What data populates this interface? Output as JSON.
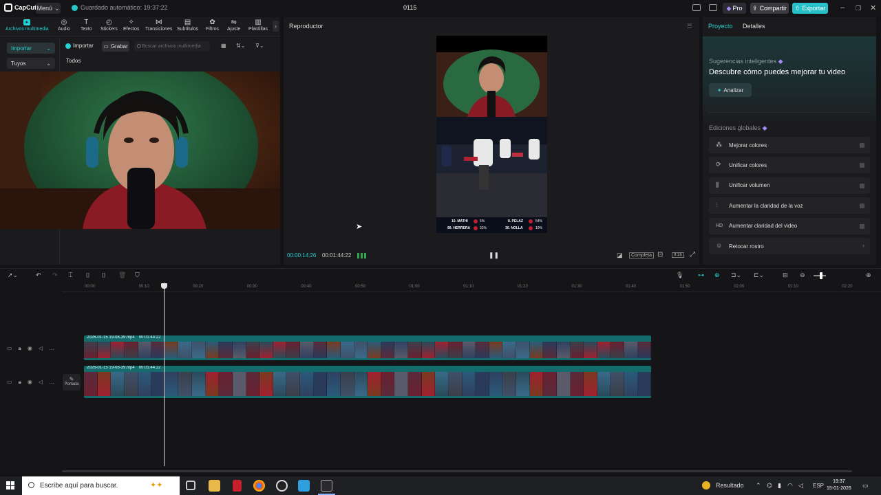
{
  "titlebar": {
    "app_name": "CapCut",
    "menu_label": "Menú",
    "autosave": "Guardado automático: 19:37:22",
    "project_name": "0115",
    "pro_label": "Pro",
    "share_label": "Compartir",
    "export_label": "Exportar"
  },
  "toolbar": {
    "tools": [
      {
        "label": "Archivos multimedia",
        "icon": "media-icon"
      },
      {
        "label": "Audio",
        "icon": "audio-icon"
      },
      {
        "label": "Texto",
        "icon": "text-icon"
      },
      {
        "label": "Stickers",
        "icon": "sticker-icon"
      },
      {
        "label": "Efectos",
        "icon": "effects-icon"
      },
      {
        "label": "Transiciones",
        "icon": "transitions-icon"
      },
      {
        "label": "Subtítulos",
        "icon": "subtitles-icon"
      },
      {
        "label": "Filtros",
        "icon": "filters-icon"
      },
      {
        "label": "Ajuste",
        "icon": "adjust-icon"
      },
      {
        "label": "Plantillas",
        "icon": "templates-icon"
      }
    ]
  },
  "media": {
    "import_side": "Importar",
    "yours": "Tuyos",
    "import_btn": "Importar",
    "record_btn": "Grabar",
    "search_placeholder": "Buscar archivos multimedia",
    "filter_all": "Todos"
  },
  "player": {
    "title": "Reproductor",
    "current_time": "00:00:14:26",
    "total_time": "00:01:44:22",
    "full_label": "Completa",
    "ratio_label": "9:16",
    "scoreboard": [
      {
        "left_name": "10. MATHI",
        "left_pct": "5%",
        "right_name": "8. PELAZ",
        "right_pct": "54%"
      },
      {
        "left_name": "99. HERRERA",
        "left_pct": "31%",
        "right_name": "30. NOLLA",
        "right_pct": "10%"
      }
    ]
  },
  "rightpanel": {
    "tab_project": "Proyecto",
    "tab_details": "Detalles",
    "smart_title": "Sugerencias inteligentes",
    "smart_headline": "Descubre cómo puedes mejorar tu video",
    "analyze": "Analizar",
    "global_title": "Ediciones globales",
    "options": [
      {
        "label": "Mejorar colores",
        "icon": "wand-icon"
      },
      {
        "label": "Unificar colores",
        "icon": "palette-icon"
      },
      {
        "label": "Unificar volumen",
        "icon": "volume-bars-icon"
      },
      {
        "label": "Aumentar la claridad de la voz",
        "icon": "waveform-icon"
      },
      {
        "label": "Aumentar claridad del video",
        "icon": "hd-icon"
      },
      {
        "label": "Retocar rostro",
        "icon": "face-icon"
      }
    ]
  },
  "timeline": {
    "ruler": [
      "00:00",
      "00:10",
      "00:20",
      "00:30",
      "00:40",
      "00:50",
      "01:00",
      "01:10",
      "01:20",
      "01:30",
      "01:40",
      "01:50",
      "02:00",
      "02:10",
      "02:20"
    ],
    "cover_label": "Portada",
    "clips": [
      {
        "name": "2026-01-15 19-08-39.mp4",
        "duration": "00:01:44:22"
      },
      {
        "name": "2026-01-15 19-08-39.mp4",
        "duration": "00:01:44:22"
      }
    ]
  },
  "taskbar": {
    "search_placeholder": "Escribe aquí para buscar.",
    "weather": "Resultado",
    "lang": "ESP",
    "time": "19:37",
    "date": "15-01-2026"
  }
}
